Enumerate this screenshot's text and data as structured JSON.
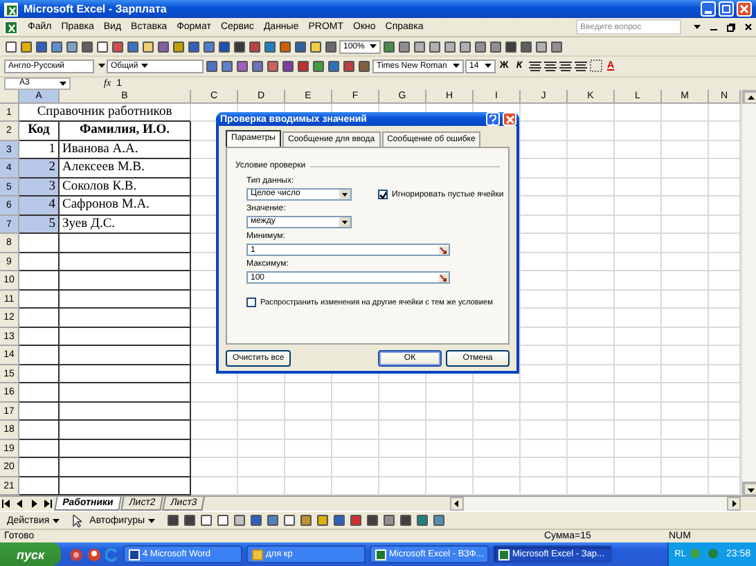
{
  "window": {
    "title": "Microsoft Excel - Зарплата"
  },
  "menu": [
    "Файл",
    "Правка",
    "Вид",
    "Вставка",
    "Формат",
    "Сервис",
    "Данные",
    "PROMT",
    "Окно",
    "Справка"
  ],
  "help_search": {
    "placeholder": "Введите вопрос"
  },
  "toolbar": {
    "zoom": "100%",
    "dictionary": "Англо-Русский",
    "number_format": "Общий",
    "font": "Times New Roman",
    "size": "14",
    "bold_label": "Ж",
    "italic_label": "К",
    "font_color_label": "A"
  },
  "formula_bar": {
    "cell": "A3",
    "function_label": "fx",
    "value": "1"
  },
  "columns": [
    {
      "label": "A",
      "selected": true
    },
    {
      "label": "B",
      "selected": false
    },
    {
      "label": "C",
      "selected": false
    },
    {
      "label": "D",
      "selected": false
    },
    {
      "label": "E",
      "selected": false
    },
    {
      "label": "F",
      "selected": false
    },
    {
      "label": "G",
      "selected": false
    },
    {
      "label": "H",
      "selected": false
    },
    {
      "label": "I",
      "selected": false
    },
    {
      "label": "J",
      "selected": false
    },
    {
      "label": "K",
      "selected": false
    },
    {
      "label": "L",
      "selected": false
    },
    {
      "label": "M",
      "selected": false
    },
    {
      "label": "N",
      "selected": false
    }
  ],
  "rows": [
    {
      "number": "1",
      "kind": "title",
      "selected": false,
      "text": "Справочник работников"
    },
    {
      "number": "2",
      "kind": "header",
      "selected": false,
      "a": "Код",
      "b": "Фамилия, И.О."
    },
    {
      "number": "3",
      "kind": "data",
      "selected": true,
      "active": true,
      "a": "1",
      "b": "Иванова А.А."
    },
    {
      "number": "4",
      "kind": "data",
      "selected": true,
      "active": false,
      "a": "2",
      "b": "Алексеев М.В."
    },
    {
      "number": "5",
      "kind": "data",
      "selected": true,
      "active": false,
      "a": "3",
      "b": "Соколов К.В."
    },
    {
      "number": "6",
      "kind": "data",
      "selected": true,
      "active": false,
      "a": "4",
      "b": "Сафронов М.А."
    },
    {
      "number": "7",
      "kind": "data",
      "selected": true,
      "active": false,
      "a": "5",
      "b": "Зуев Д.С."
    },
    {
      "number": "8",
      "kind": "empty",
      "selected": false
    },
    {
      "number": "9",
      "kind": "empty",
      "selected": false
    },
    {
      "number": "10",
      "kind": "empty",
      "selected": false
    },
    {
      "number": "11",
      "kind": "empty",
      "selected": false
    },
    {
      "number": "12",
      "kind": "empty",
      "selected": false
    },
    {
      "number": "13",
      "kind": "empty",
      "selected": false
    },
    {
      "number": "14",
      "kind": "empty",
      "selected": false
    },
    {
      "number": "15",
      "kind": "empty",
      "selected": false
    },
    {
      "number": "16",
      "kind": "empty",
      "selected": false
    },
    {
      "number": "17",
      "kind": "empty",
      "selected": false
    },
    {
      "number": "18",
      "kind": "empty",
      "selected": false
    },
    {
      "number": "19",
      "kind": "empty",
      "selected": false
    },
    {
      "number": "20",
      "kind": "empty",
      "selected": false
    },
    {
      "number": "21",
      "kind": "empty",
      "selected": false
    }
  ],
  "dialog": {
    "title": "Проверка вводимых значений",
    "tabs": [
      {
        "label": "Параметры",
        "selected": true
      },
      {
        "label": "Сообщение для ввода",
        "selected": false
      },
      {
        "label": "Сообщение об ошибке",
        "selected": false
      }
    ],
    "group": "Условие проверки",
    "data_type": {
      "label": "Тип данных:",
      "value": "Целое число"
    },
    "ignore_blank": {
      "label": "Игнорировать пустые ячейки",
      "checked": true
    },
    "operator": {
      "label": "Значение:",
      "value": "между"
    },
    "minimum": {
      "label": "Минимум:",
      "value": "1"
    },
    "maximum": {
      "label": "Максимум:",
      "value": "100"
    },
    "apply_all": {
      "label": "Распространить изменения на другие ячейки с тем же условием",
      "checked": false
    },
    "buttons": [
      {
        "label": "Очистить все",
        "kind": "left"
      },
      {
        "label": "ОК",
        "kind": "default"
      },
      {
        "label": "Отмена",
        "kind": "normal"
      }
    ]
  },
  "sheet_tabs": [
    {
      "label": "Работники",
      "selected": true
    },
    {
      "label": "Лист2",
      "selected": false
    },
    {
      "label": "Лист3",
      "selected": false
    }
  ],
  "drawing_toolbar": {
    "actions": "Действия",
    "autoshapes": "Автофигуры"
  },
  "status_bar": {
    "state": "Готово",
    "sum": "Сумма=15",
    "num": "NUM"
  },
  "taskbar": {
    "start": "пуск",
    "tasks": [
      {
        "label": "4 Microsoft Word",
        "kind": "word",
        "selected": false
      },
      {
        "label": "для кр",
        "kind": "folder",
        "selected": false
      },
      {
        "label": "Microsoft Excel - ВЗФ...",
        "kind": "excel",
        "selected": false
      },
      {
        "label": "Microsoft Excel - Зар...",
        "kind": "excel",
        "selected": true
      }
    ],
    "language": "RL",
    "clock": "23:58"
  }
}
